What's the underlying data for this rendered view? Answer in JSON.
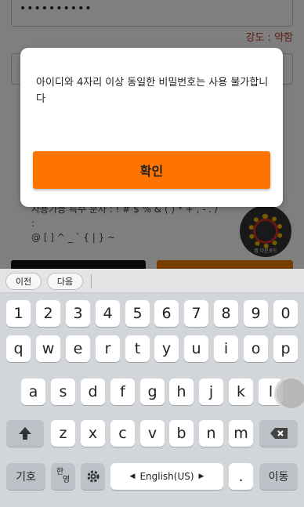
{
  "background": {
    "password_value": "••••••••••",
    "strength_label": "강도 : 약함",
    "note_line1": "사용가능 특수 문자 : ! # $ % & ( ) * + , - . / :",
    "note_line2": "@ [ ] ^ _ ` { | } ~",
    "badge_label": "앱 다운로드"
  },
  "modal": {
    "message": "아이디와 4자리 이상 동일한 비밀번호는 사용 불가합니다",
    "ok_label": "확인"
  },
  "keyboard": {
    "prev_label": "이전",
    "next_label": "다음",
    "row1": [
      "1",
      "2",
      "3",
      "4",
      "5",
      "6",
      "7",
      "8",
      "9",
      "0"
    ],
    "row2": [
      "q",
      "w",
      "e",
      "r",
      "t",
      "y",
      "u",
      "i",
      "o",
      "p"
    ],
    "row3": [
      "a",
      "s",
      "d",
      "f",
      "g",
      "h",
      "j",
      "k",
      "l"
    ],
    "row4": [
      "z",
      "x",
      "c",
      "v",
      "b",
      "n",
      "m"
    ],
    "symbols_label": "기호",
    "lang_top": "한",
    "lang_bottom": "영",
    "space_label": "English(US)",
    "period_label": ".",
    "go_label": "이동"
  }
}
